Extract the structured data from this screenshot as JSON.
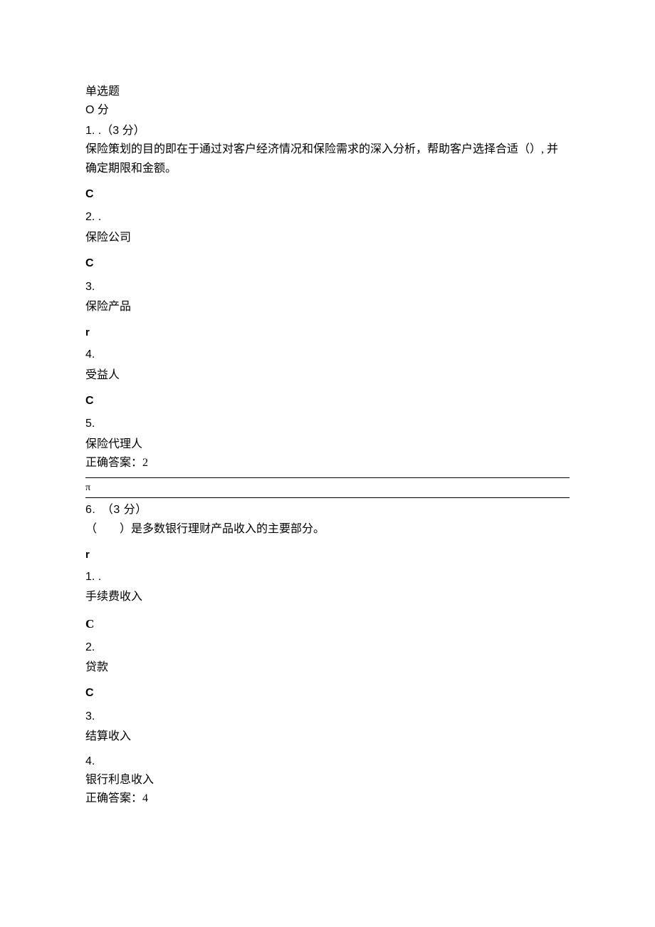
{
  "header": {
    "section_title": "单选题",
    "score_line": "O 分"
  },
  "q1": {
    "number_points": "1. .（3 分）",
    "stem_line1": "保险策划的目的即在于通过对客户经济情况和保险需求的深入分析，帮助客户选择合适（）, 并",
    "stem_line2": "确定期限和金额。",
    "mark1": "C",
    "opt1_num": "2. .",
    "opt1_text": "保险公司",
    "mark2": "C",
    "opt2_num": "3.",
    "opt2_text": "保险产品",
    "mark3": "r",
    "opt3_num": "4.",
    "opt3_text": "受益人",
    "mark4": "C",
    "opt4_num": "5.",
    "opt4_text": "保险代理人",
    "answer": "正确答案：2"
  },
  "divider_glyph": "π",
  "q2": {
    "number_points": "6.　（3 分）",
    "stem": "（　　）是多数银行理财产品收入的主要部分。",
    "mark1": "r",
    "opt1_num": "1. .",
    "opt1_text": "手续费收入",
    "mark2": "C",
    "opt2_num": "2.",
    "opt2_text": "贷款",
    "mark3": "C",
    "opt3_num": "3.",
    "opt3_text": "结算收入",
    "opt4_num": "4.",
    "opt4_text": "银行利息收入",
    "answer": "正确答案：4"
  }
}
